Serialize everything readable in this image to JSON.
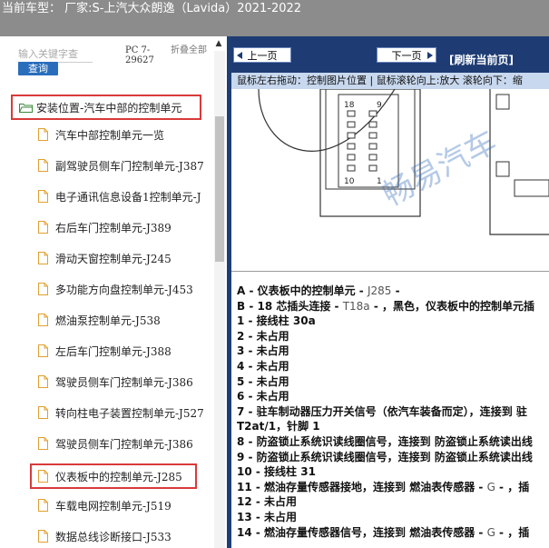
{
  "title_bar": {
    "text": "当前车型：  厂家:S-上汽大众朗逸（Lavida）2021-2022"
  },
  "search": {
    "placeholder": "输入关键字查",
    "button_label": "查询",
    "pc_label": "PC 7-29627",
    "fold_label": "折叠全部"
  },
  "tree": {
    "root_label": "安装位置-汽车中部的控制单元",
    "items": [
      {
        "label": "汽车中部控制单元一览"
      },
      {
        "label": "副驾驶员侧车门控制单元-J387"
      },
      {
        "label": "电子通讯信息设备1控制单元-J"
      },
      {
        "label": "右后车门控制单元-J389"
      },
      {
        "label": "滑动天窗控制单元-J245"
      },
      {
        "label": "多功能方向盘控制单元-J453"
      },
      {
        "label": "燃油泵控制单元-J538"
      },
      {
        "label": "左后车门控制单元-J388"
      },
      {
        "label": "驾驶员侧车门控制单元-J386"
      },
      {
        "label": "转向柱电子装置控制单元-J527"
      },
      {
        "label": "驾驶员侧车门控制单元-J386"
      },
      {
        "label": "仪表板中的控制单元-J285",
        "selected": true
      },
      {
        "label": "车载电网控制单元-J519"
      },
      {
        "label": "数据总线诊断接口-J533"
      }
    ]
  },
  "viewer": {
    "prev_label": "上一页",
    "next_label": "下一页",
    "refresh_label": "[刷新当前页]",
    "hint": "鼠标左右拖动：控制图片位置 | 鼠标滚轮向上:放大  滚轮向下：缩",
    "watermark": "畅易汽车",
    "pin_top_label": "18",
    "pin_top_right_label": "9",
    "pin_bottom_label": "10",
    "pin_bottom_right_label": "1"
  },
  "description": {
    "lines": [
      {
        "main": "A - 仪表板中的控制单元 - ",
        "muted": "J285",
        "tail": " -"
      },
      {
        "main": "B - 18 芯插头连接 - ",
        "muted": "T18a",
        "tail": " - ，黑色，仪表板中的控制单元插"
      },
      {
        "main": "1 - 接线柱 30a",
        "muted": "",
        "tail": ""
      },
      {
        "main": "2 - 未占用",
        "muted": "",
        "tail": ""
      },
      {
        "main": "3 - 未占用",
        "muted": "",
        "tail": ""
      },
      {
        "main": "4 - 未占用",
        "muted": "",
        "tail": ""
      },
      {
        "main": "5 - 未占用",
        "muted": "",
        "tail": ""
      },
      {
        "main": "6 - 未占用",
        "muted": "",
        "tail": ""
      },
      {
        "main": "7 - 驻车制动器压力开关信号（依汽车装备而定），连接到 驻",
        "muted": "",
        "tail": ""
      },
      {
        "main": "    T2at/1，针脚 1",
        "muted": "",
        "tail": ""
      },
      {
        "main": "8 - 防盗锁止系统识读线圈信号，连接到 防盗锁止系统读出线",
        "muted": "",
        "tail": ""
      },
      {
        "main": "9 - 防盗锁止系统识读线圈信号，连接到 防盗锁止系统读出线",
        "muted": "",
        "tail": ""
      },
      {
        "main": "10 - 接线柱 31",
        "muted": "",
        "tail": ""
      },
      {
        "main": "11 - 燃油存量传感器接地，连接到 燃油表传感器 - ",
        "muted": "G",
        "tail": " - ，插"
      },
      {
        "main": "12 - 未占用",
        "muted": "",
        "tail": ""
      },
      {
        "main": "13 - 未占用",
        "muted": "",
        "tail": ""
      },
      {
        "main": "14 - 燃油存量传感器信号，连接到 燃油表传感器 - ",
        "muted": "G",
        "tail": " - ，插"
      }
    ]
  },
  "colors": {
    "title_bg": "#8c8c8c",
    "nav_bg": "#1e3c73",
    "highlight_border": "#d93a3a",
    "hint_bg": "#c8d8ee",
    "search_button": "#2a6ebb"
  }
}
